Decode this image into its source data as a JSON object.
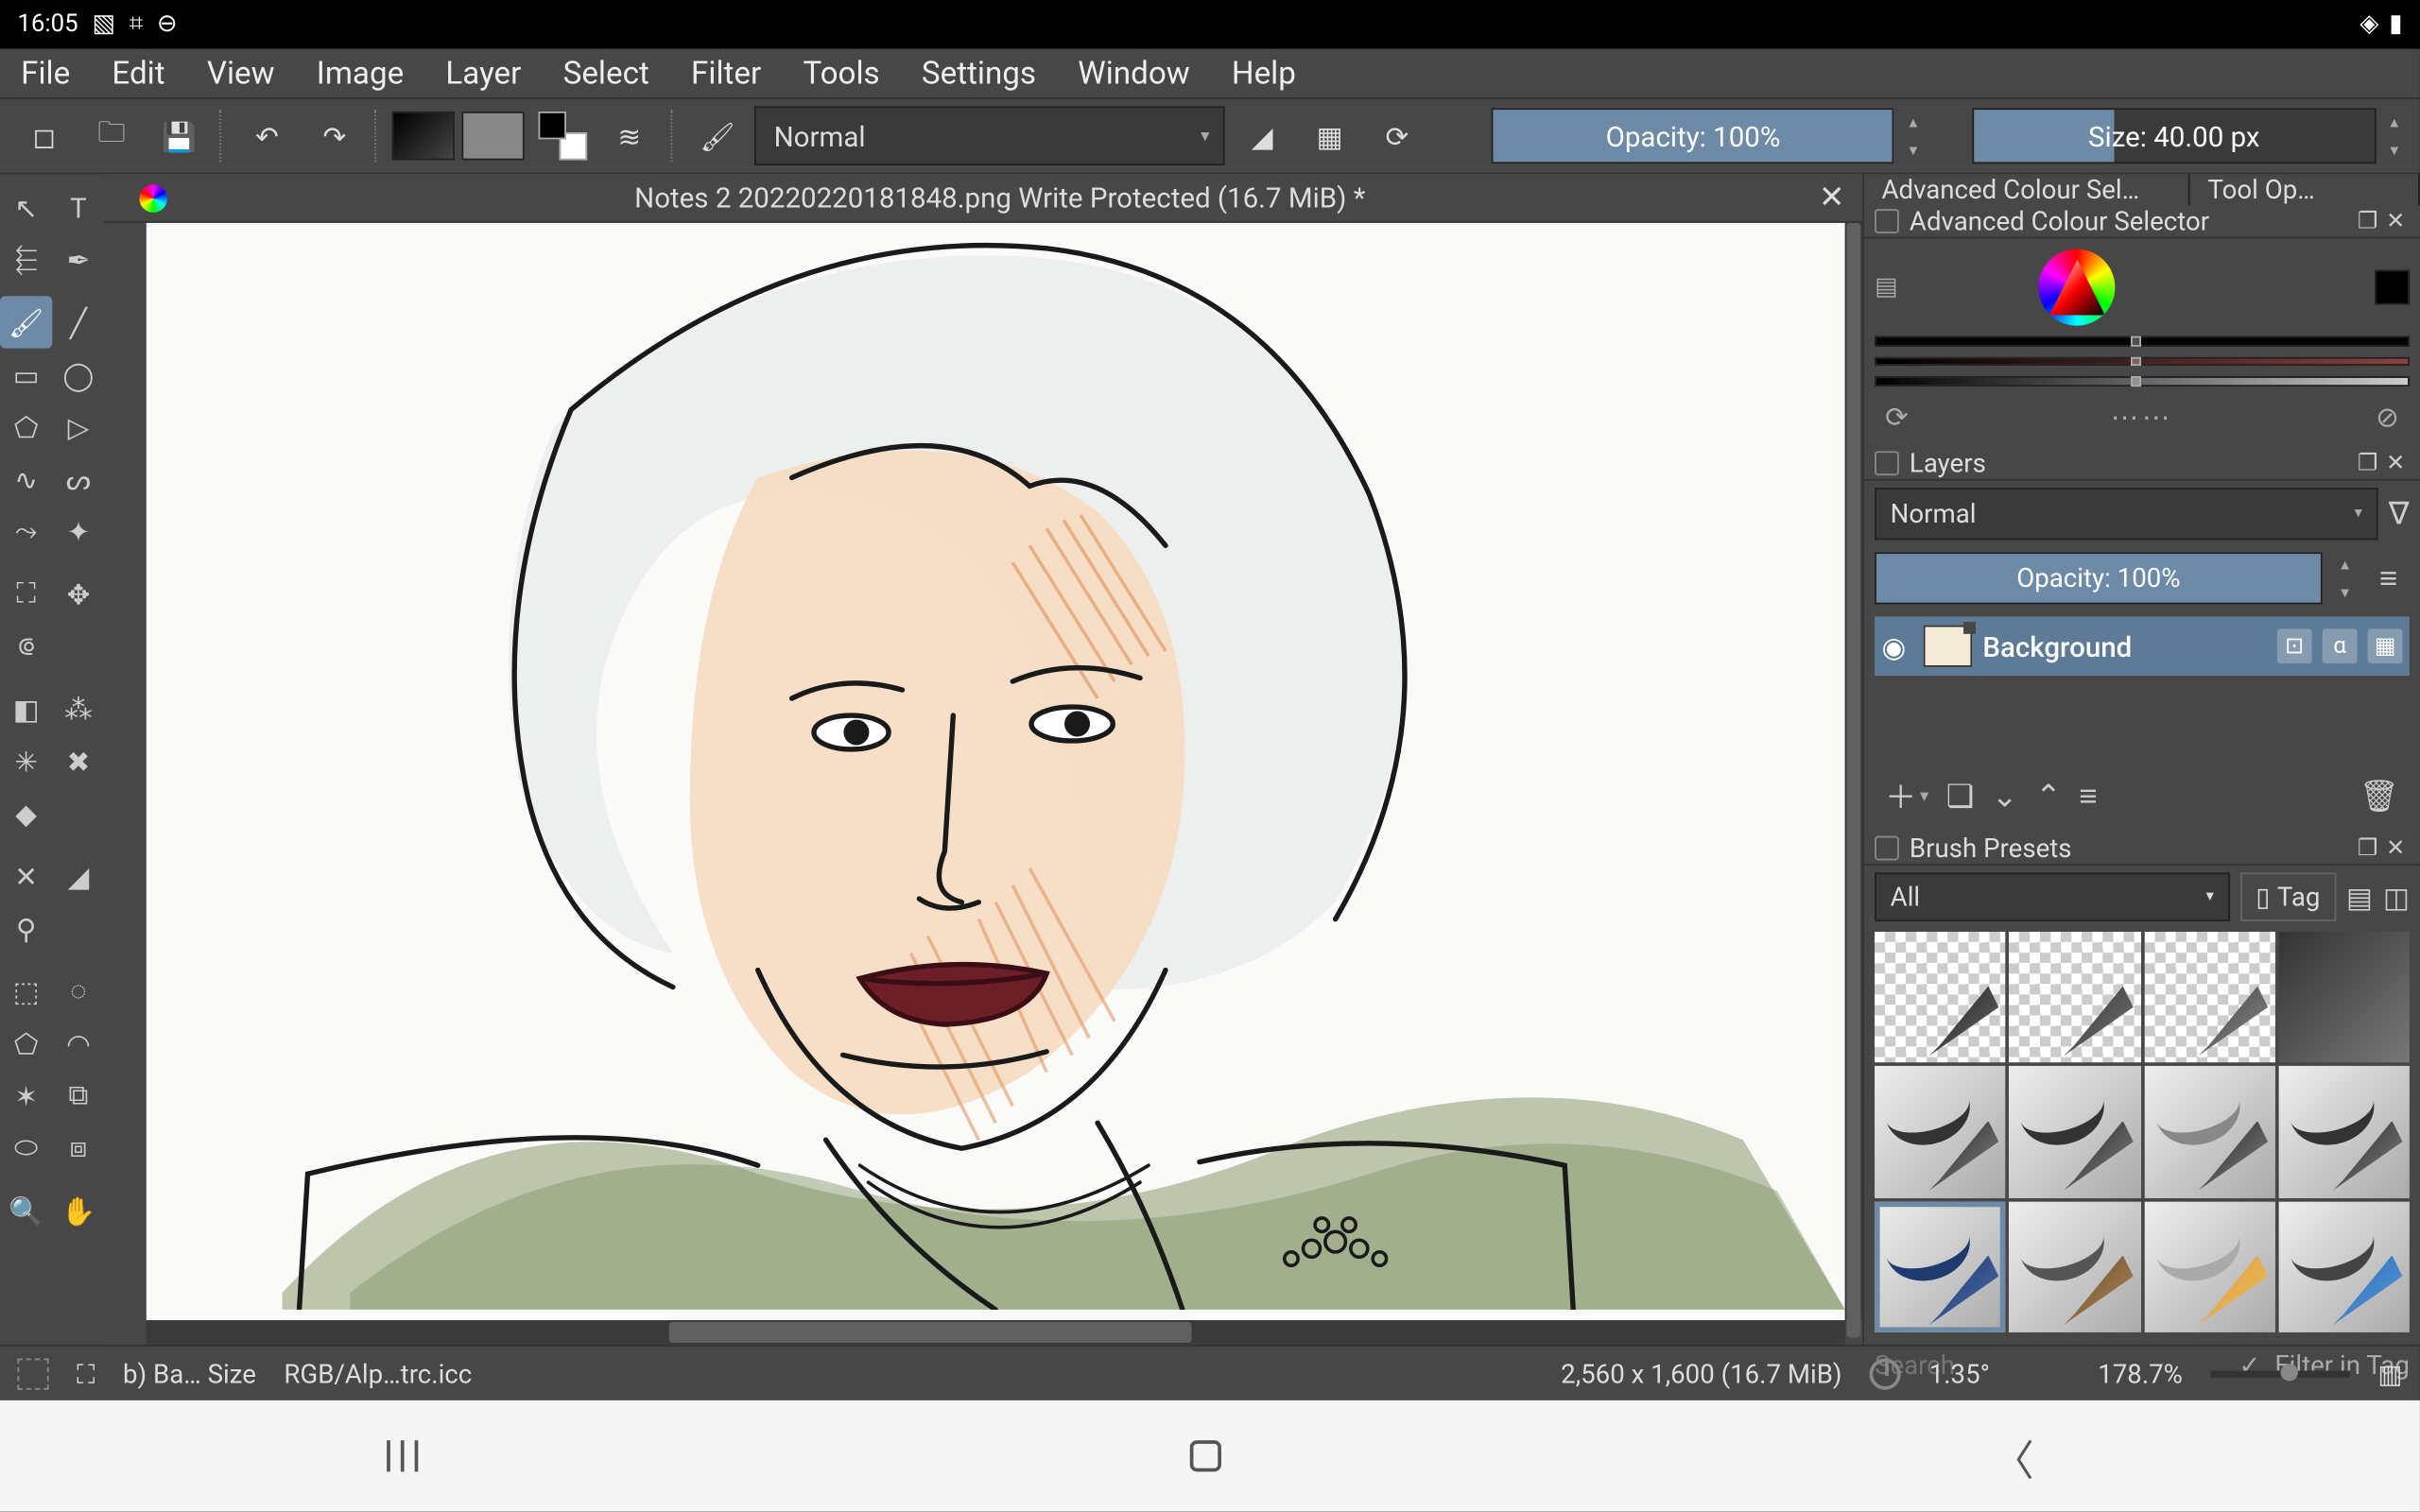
{
  "android_status": {
    "time": "16:05"
  },
  "menubar": [
    "File",
    "Edit",
    "View",
    "Image",
    "Layer",
    "Select",
    "Filter",
    "Tools",
    "Settings",
    "Window",
    "Help"
  ],
  "toolbar": {
    "blend_mode": "Normal",
    "opacity_label": "Opacity: 100%",
    "size_label": "Size: 40.00 px"
  },
  "document": {
    "title": "Notes 2 20220220181848.png Write Protected  (16.7 MiB)  *"
  },
  "right_tabs": {
    "tab1": "Advanced Colour Sel…",
    "tab2": "Tool Op…"
  },
  "colour_panel": {
    "title": "Advanced Colour Selector"
  },
  "layers_panel": {
    "title": "Layers",
    "blend_mode": "Normal",
    "opacity_label": "Opacity:  100%",
    "layer_name": "Background",
    "alpha_badge": "α"
  },
  "brush_panel": {
    "title": "Brush Presets",
    "filter": "All",
    "tag_label": "Tag",
    "search_placeholder": "Search",
    "filter_in_tag": "Filter in Tag"
  },
  "statusbar": {
    "left1": "b) Ba… Size",
    "left2": "RGB/Alp…trc.icc",
    "dims": "2,560 x 1,600 (16.7 MiB)",
    "angle": "1.35°",
    "zoom": "178.7%"
  }
}
